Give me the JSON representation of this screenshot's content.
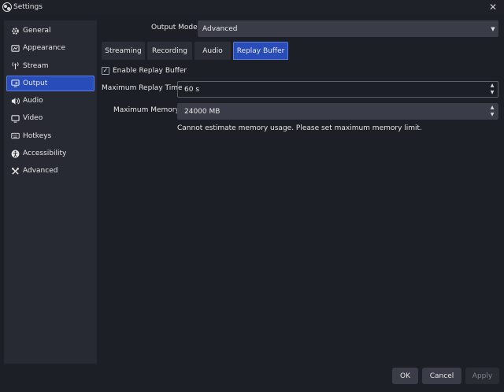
{
  "window": {
    "title": "Settings",
    "close_glyph": "✕"
  },
  "sidebar": {
    "items": [
      {
        "label": "General",
        "icon": "gear-icon",
        "active": false
      },
      {
        "label": "Appearance",
        "icon": "palette-icon",
        "active": false
      },
      {
        "label": "Stream",
        "icon": "broadcast-icon",
        "active": false
      },
      {
        "label": "Output",
        "icon": "monitor-output-icon",
        "active": true
      },
      {
        "label": "Audio",
        "icon": "speaker-icon",
        "active": false
      },
      {
        "label": "Video",
        "icon": "monitor-icon",
        "active": false
      },
      {
        "label": "Hotkeys",
        "icon": "keyboard-icon",
        "active": false
      },
      {
        "label": "Accessibility",
        "icon": "accessibility-icon",
        "active": false
      },
      {
        "label": "Advanced",
        "icon": "tools-icon",
        "active": false
      }
    ]
  },
  "output_mode": {
    "label": "Output Mode",
    "value": "Advanced"
  },
  "tabs": [
    {
      "label": "Streaming",
      "active": false
    },
    {
      "label": "Recording",
      "active": false
    },
    {
      "label": "Audio",
      "active": false
    },
    {
      "label": "Replay Buffer",
      "active": true
    }
  ],
  "replay_buffer": {
    "enable_label": "Enable Replay Buffer",
    "enabled": true,
    "max_time_label": "Maximum Replay Time",
    "max_time_value": "60 s",
    "max_memory_label": "Maximum Memory",
    "max_memory_value": "24000 MB",
    "memory_note": "Cannot estimate memory usage. Please set maximum memory limit."
  },
  "buttons": {
    "ok": "OK",
    "cancel": "Cancel",
    "apply": "Apply"
  },
  "colors": {
    "accent": "#284cb8",
    "background": "#1d1f26",
    "panel": "#272a33"
  }
}
